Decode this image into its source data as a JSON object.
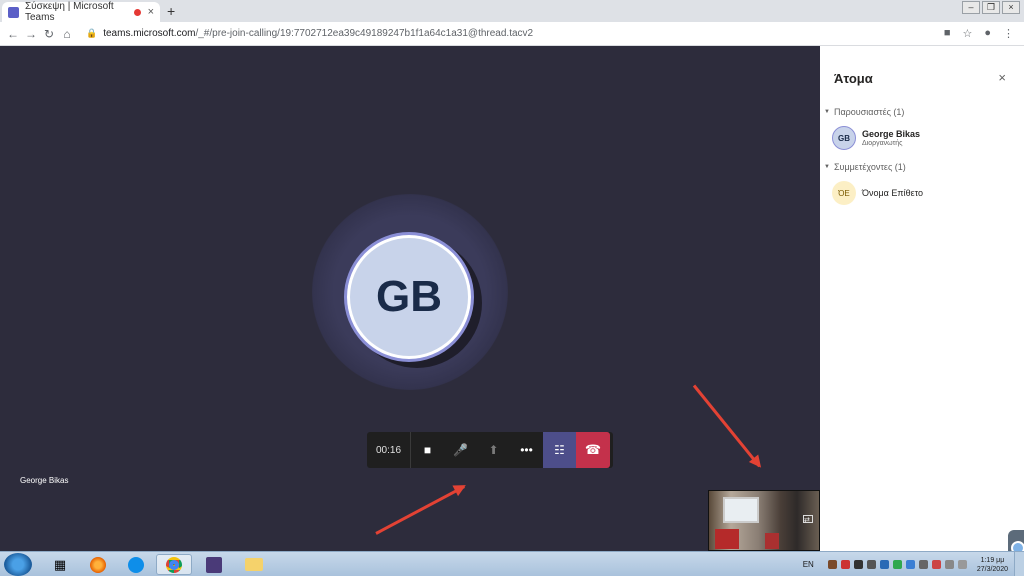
{
  "browser": {
    "tab_title": "Σύσκεψη | Microsoft Teams",
    "tab_close": "×",
    "new_tab": "+",
    "url_host": "teams.microsoft.com",
    "url_path": "/_#/pre-join-calling/19:7702712ea39c49189247b1f1a64c1a31@thread.tacv2",
    "window_controls": {
      "minimize": "–",
      "maximize": "❐",
      "close": "×"
    }
  },
  "call": {
    "avatar_initials": "GB",
    "timer": "00:16",
    "participant_label": "George Bikas",
    "controls": {
      "video_icon": "■",
      "mic_icon": "🎤",
      "share_icon": "⬆",
      "more_icon": "•••",
      "participants_icon": "☷",
      "hangup_icon": "☎"
    },
    "self_view_icon": "⇄"
  },
  "people_panel": {
    "title": "Άτομα",
    "close_icon": "×",
    "presenters_header": "Παρουσιαστές (1)",
    "participants_header": "Συμμετέχοντες (1)",
    "presenters": [
      {
        "initials": "GB",
        "name": "George Bikas",
        "role": "Διοργανωτής"
      }
    ],
    "participants": [
      {
        "initials": "ΌΕ",
        "name": "Όνομα Επίθετο"
      }
    ]
  },
  "taskbar": {
    "language": "EN",
    "time": "1:19 μμ",
    "date": "27/3/2020"
  }
}
